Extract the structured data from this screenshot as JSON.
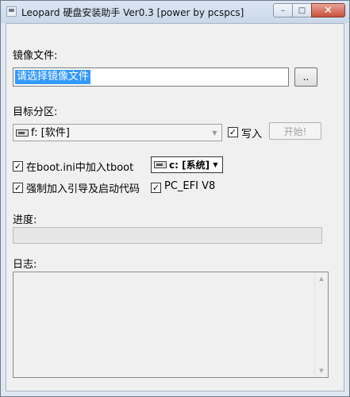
{
  "window": {
    "title": "Leopard 硬盘安装助手 Ver0.3 [power by pcspcs]",
    "min_glyph": "–",
    "max_glyph": "□",
    "close_glyph": "✕"
  },
  "image_file": {
    "label": "镜像文件:",
    "value": "请选择镜像文件",
    "browse_label": ".."
  },
  "target_partition": {
    "label": "目标分区:",
    "selected": "f: [软件]",
    "write_label": "写入",
    "write_checked": "✓",
    "start_label": "开始!"
  },
  "boot_ini": {
    "label": "在boot.ini中加入tboot",
    "checked": "✓",
    "drive_selected": "c: [系统]"
  },
  "force_boot": {
    "label": "强制加入引导及启动代码",
    "checked": "✓"
  },
  "pc_efi": {
    "label": "PC_EFI V8",
    "checked": "✓"
  },
  "progress": {
    "label": "进度:",
    "value": 0
  },
  "log": {
    "label": "日志:",
    "content": ""
  },
  "icons": {
    "combo_arrow": "▼",
    "scroll_up": "▲",
    "scroll_down": "▼"
  }
}
